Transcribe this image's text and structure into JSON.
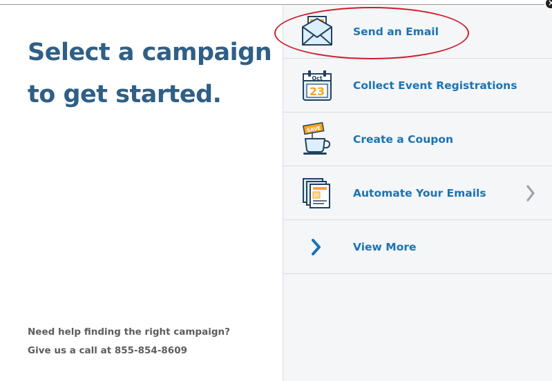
{
  "headline": {
    "line1": "Select a campaign",
    "line2": "to get started."
  },
  "help": {
    "line1": "Need help finding the right campaign?",
    "line2": "Give us a call at 855-854-8609"
  },
  "campaigns": [
    {
      "label": "Send an Email",
      "icon": "envelope-icon"
    },
    {
      "label": "Collect Event Registrations",
      "icon": "calendar-icon",
      "calendar_month": "Oct",
      "calendar_day": "23"
    },
    {
      "label": "Create a Coupon",
      "icon": "coupon-cup-icon",
      "badge": "SAVE"
    },
    {
      "label": "Automate Your Emails",
      "icon": "stacked-emails-icon",
      "has_arrow": true
    },
    {
      "label": "View More",
      "icon": "chevron-right-icon"
    }
  ],
  "colors": {
    "headline": "#2f5f86",
    "link": "#1b73b3",
    "help_text": "#5d5d5d",
    "panel_bg": "#f4f6f8",
    "annotation": "#d01a2a",
    "icon_orange": "#f5a623",
    "icon_navy": "#23405e"
  }
}
